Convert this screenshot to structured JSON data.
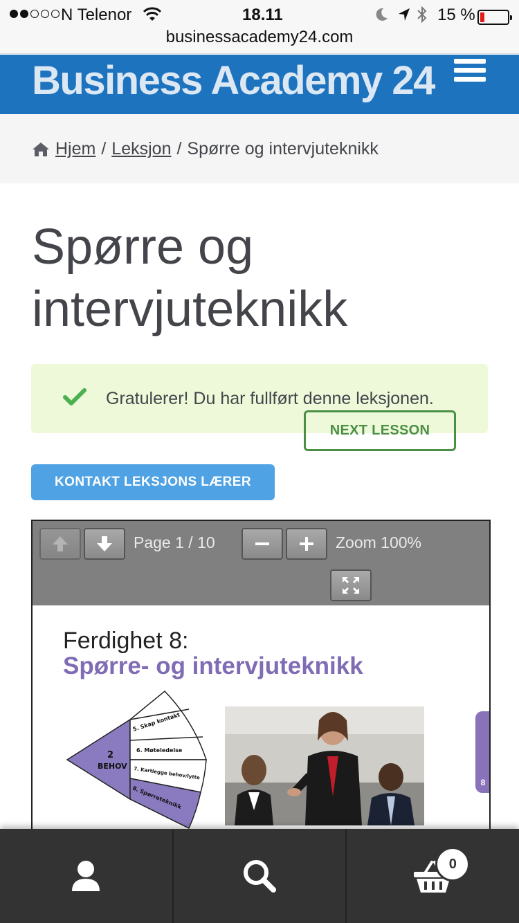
{
  "status_bar": {
    "carrier": "N Telenor",
    "time": "18.11",
    "battery": "15 %",
    "url": "businessacademy24.com"
  },
  "header": {
    "site_title": "Business Academy 24"
  },
  "breadcrumb": {
    "home": "Hjem",
    "sep1": "/",
    "lesson": "Leksjon",
    "sep2": "/",
    "current": "Spørre og intervjuteknikk"
  },
  "page": {
    "title": "Spørre og intervjuteknikk"
  },
  "notice": {
    "text": "Gratulerer! Du har fullført denne leksjonen.",
    "next_label": "NEXT LESSON"
  },
  "contact_button": "KONTAKT LEKSJONS LÆRER",
  "pdf_viewer": {
    "page_label": "Page 1 / 10",
    "zoom_label": "Zoom 100%",
    "slide": {
      "heading": "Ferdighet 8:",
      "subheading": "Spørre- og intervjuteknikk",
      "wheel_center_number": "2",
      "wheel_center_label": "BEHOV",
      "wheel_segments": [
        "5. Skap kontakt",
        "6. Møteledelse",
        "7. Kartlegge behov/lytte",
        "8. Spørreteknikk"
      ],
      "side_tab": "8"
    }
  },
  "bottom_nav": {
    "cart_count": "0"
  },
  "colors": {
    "header_blue": "#1e73be",
    "notice_green_bg": "#eef9d9",
    "next_green": "#4b8f46",
    "contact_blue": "#4fa2e3",
    "slide_purple": "#7f6cb4"
  }
}
